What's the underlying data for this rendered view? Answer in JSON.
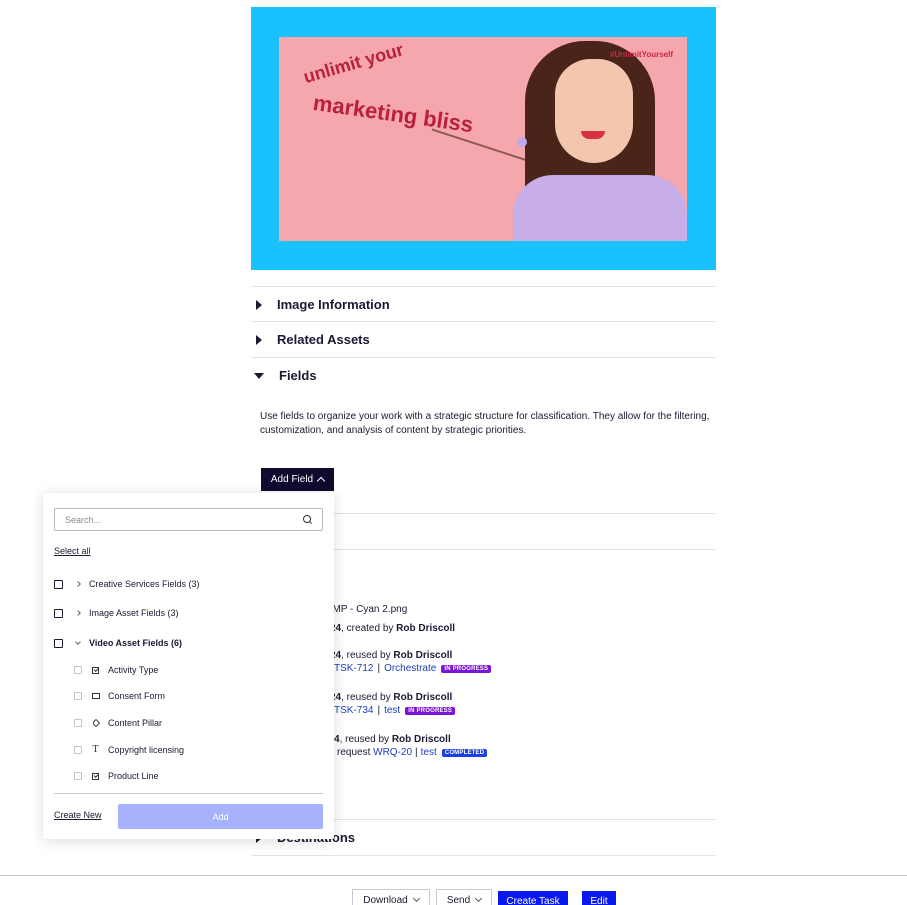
{
  "preview": {
    "hashtag": "#UnlimitYourself",
    "headline_line1": "unlimit your",
    "headline_line2": "marketing bliss",
    "colors": {
      "border": "#19c2ff",
      "background": "#f6a6ad",
      "text": "#b8203b"
    }
  },
  "accordion": [
    {
      "label": "Image Information",
      "expanded": false
    },
    {
      "label": "Related Assets",
      "expanded": false
    },
    {
      "label": "Fields",
      "expanded": true
    }
  ],
  "fields": {
    "description": "Use fields to organize your work with a strategic structure for classification. They allow for the filtering, customization, and analysis of content by strategic priorities.",
    "add_field_label": "Add Field"
  },
  "dropdown": {
    "search_placeholder": "Search...",
    "select_all": "Select all",
    "groups": [
      {
        "label": "Creative Services Fields (3)",
        "expanded": false
      },
      {
        "label": "Image Asset Fields (3)",
        "expanded": false
      },
      {
        "label": "Video Asset Fields (6)",
        "expanded": true
      }
    ],
    "items": [
      {
        "label": "Activity Type",
        "icon": "checkbox-field-icon"
      },
      {
        "label": "Consent Form",
        "icon": "image-field-icon"
      },
      {
        "label": "Content Pillar",
        "icon": "tag-field-icon"
      },
      {
        "label": "Copyright licensing",
        "icon": "text-field-icon"
      },
      {
        "label": "Product Line",
        "icon": "checkbox-field-icon"
      }
    ],
    "create_new": "Create New",
    "add_label": "Add"
  },
  "usage": {
    "filename_partial": "r - CMP - Cyan 2.png",
    "created": {
      "date_partial": "24",
      "action": ", created by ",
      "user": "Rob Driscoll"
    },
    "entries": [
      {
        "date_partial": "24",
        "action": ", reused by ",
        "user": "Rob Driscoll",
        "prefix": "",
        "ref": "TSK-712",
        "project": "Orchestrate",
        "status": "IN PROGRESS"
      },
      {
        "date_partial": "24",
        "action": ", reused by ",
        "user": "Rob Driscoll",
        "prefix": "",
        "ref": "TSK-734",
        "project": "test",
        "status": "IN PROGRESS"
      },
      {
        "date_partial": "4",
        "action": ", reused by ",
        "user": "Rob Driscoll",
        "prefix": "request ",
        "ref": "WRQ-20",
        "project": "test",
        "status": "COMPLETED"
      }
    ]
  },
  "destinations_partial": "Destinations",
  "toolbar": {
    "download": "Download",
    "send": "Send",
    "create_task": "Create Task",
    "edit": "Edit"
  }
}
